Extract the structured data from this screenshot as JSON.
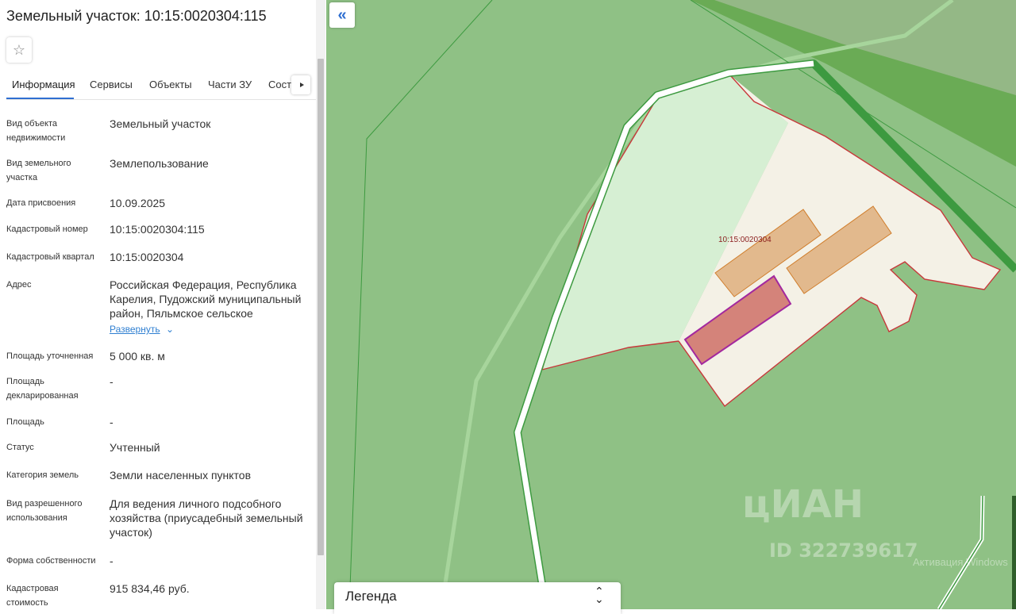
{
  "panel": {
    "title": "Земельный участок: 10:15:0020304:115",
    "favorite_icon": "star-outline-icon",
    "tabs": [
      "Информация",
      "Сервисы",
      "Объекты",
      "Части ЗУ",
      "Соста"
    ],
    "active_tab": 0,
    "fields": [
      {
        "label": "Вид объекта недвижимости",
        "value": "Земельный участок"
      },
      {
        "label": "Вид земельного участка",
        "value": "Землепользование"
      },
      {
        "label": "Дата присвоения",
        "value": "10.09.2025"
      },
      {
        "label": "Кадастровый номер",
        "value": "10:15:0020304:115"
      },
      {
        "label": "Кадастровый квартал",
        "value": "10:15:0020304"
      },
      {
        "label": "Адрес",
        "value": "Российская Федерация, Республика Карелия, Пудожский муниципальный район, Пяльмское сельское"
      },
      {
        "label": "Площадь уточненная",
        "value": "5 000 кв. м"
      },
      {
        "label": "Площадь декларированная",
        "value": "-"
      },
      {
        "label": "Площадь",
        "value": "-"
      },
      {
        "label": "Статус",
        "value": "Учтенный"
      },
      {
        "label": "Категория земель",
        "value": "Земли населенных пунктов"
      },
      {
        "label": "Вид разрешенного использования",
        "value": "Для ведения личного подсобного хозяйства (приусадебный земельный участок)"
      },
      {
        "label": "Форма собственности",
        "value": "-"
      },
      {
        "label": "Кадастровая стоимость",
        "value": "915 834,46 руб."
      }
    ],
    "address_expand": "Развернуть"
  },
  "map": {
    "parcel_label": "10:15:0020304",
    "legend_title": "Легенда",
    "watermark_logo": "цИАН",
    "watermark_id": "ID 322739617",
    "attribution": "Активация Windows",
    "colors": {
      "forest": "#8fc185",
      "dark_forest": "#6aab55",
      "parcel_fill": "#f4f1e6",
      "parcel_border": "#c7383a",
      "light_area": "#d6efd3",
      "building": "#e2b98d",
      "selected_building": "#d4837a",
      "road": "#ffffff",
      "road_edge": "#3d9a40",
      "accent": "#2f6fd1"
    }
  }
}
